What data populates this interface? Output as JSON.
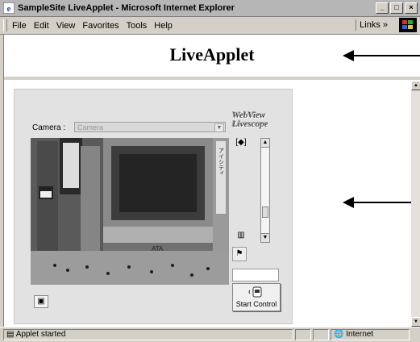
{
  "window": {
    "title": "SampleSite LiveApplet - Microsoft Internet Explorer",
    "minimize": "_",
    "maximize": "□",
    "close": "×"
  },
  "menu": {
    "items": [
      "File",
      "Edit",
      "View",
      "Favorites",
      "Tools",
      "Help"
    ],
    "links": "Links »"
  },
  "page": {
    "heading": "LiveApplet"
  },
  "applet": {
    "camera_label": "Camera :",
    "camera_value": "Camera",
    "logo_line1": "WebView",
    "logo_line2": "Livescope",
    "start_button": "Start Control"
  },
  "video": {
    "signs": [
      "ATA",
      "アイシティ"
    ]
  },
  "statusbar": {
    "text": "Applet started",
    "zone": "Internet"
  },
  "colors": {
    "window_bg": "#d4d0c8",
    "title_bg": "#b6b6b6",
    "applet_bg": "#e2e2e2",
    "page_bg": "#ffffff"
  }
}
